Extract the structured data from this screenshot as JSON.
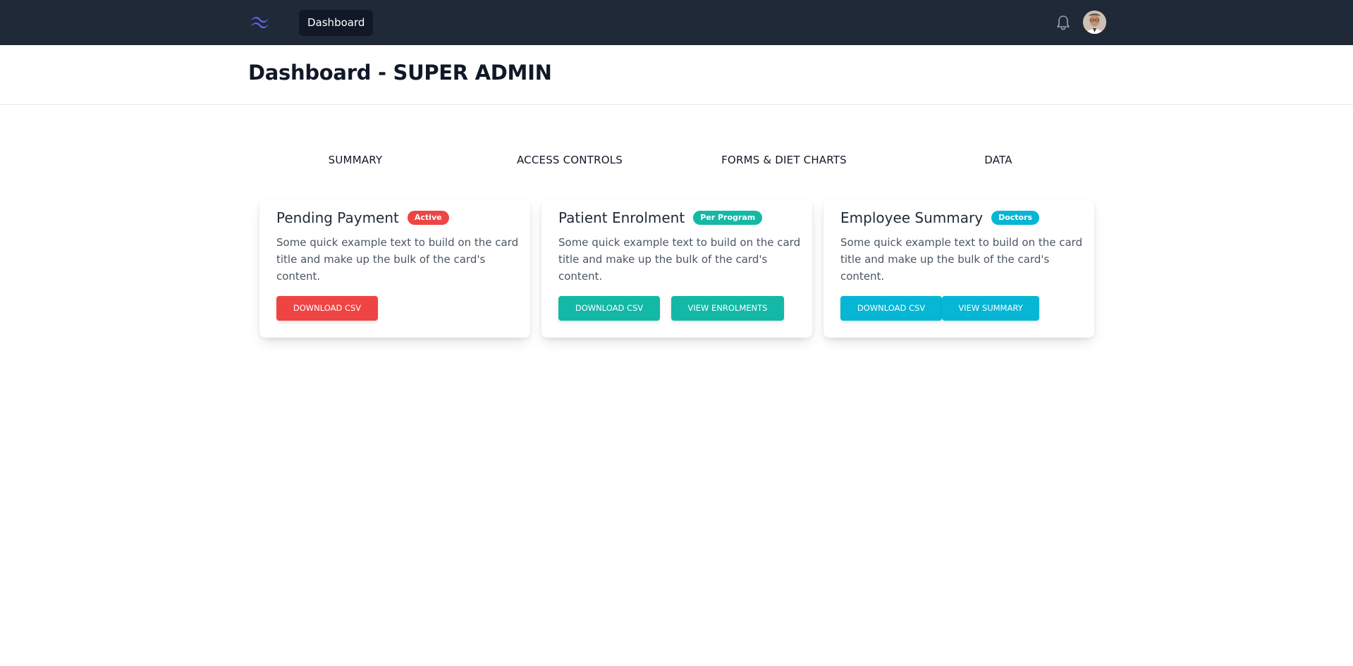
{
  "nav": {
    "dashboard_label": "Dashboard"
  },
  "header": {
    "title": "Dashboard - SUPER ADMIN"
  },
  "tabs": [
    {
      "label": "SUMMARY"
    },
    {
      "label": "ACCESS CONTROLS"
    },
    {
      "label": "FORMS & DIET CHARTS"
    },
    {
      "label": "DATA"
    }
  ],
  "cards": [
    {
      "title": "Pending Payment",
      "badge": "Active",
      "badge_color": "#ef4444",
      "text": "Some quick example text to build on the card title and make up the bulk of the card's content.",
      "buttons": [
        {
          "label": "DOWNLOAD CSV",
          "color": "#ef4444"
        }
      ]
    },
    {
      "title": "Patient Enrolment",
      "badge": "Per Program",
      "badge_color": "#14b8a6",
      "text": "Some quick example text to build on the card title and make up the bulk of the card's content.",
      "buttons": [
        {
          "label": "DOWNLOAD CSV",
          "color": "#14b8a6"
        },
        {
          "label": "VIEW ENROLMENTS",
          "color": "#14b8a6"
        }
      ]
    },
    {
      "title": "Employee Summary",
      "badge": "Doctors",
      "badge_color": "#06b6d4",
      "text": "Some quick example text to build on the card title and make up the bulk of the card's content.",
      "buttons": [
        {
          "label": "DOWNLOAD CSV",
          "color": "#06b6d4"
        },
        {
          "label": "VIEW SUMMARY",
          "color": "#06b6d4"
        }
      ]
    }
  ],
  "icons": {
    "logo": "tailwind-logo-icon",
    "notifications": "bell-icon",
    "avatar": "user-avatar"
  },
  "colors": {
    "navbar": "#1f2937",
    "nav_active": "#111827",
    "logo": "#6366f1"
  }
}
